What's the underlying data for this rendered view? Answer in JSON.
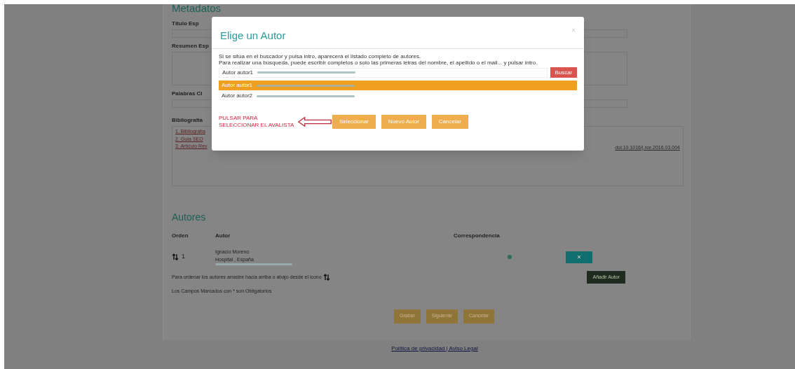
{
  "page": {
    "section_title": "Metadatos",
    "fields": [
      {
        "label": "Título Esp",
        "kind": "input"
      },
      {
        "label": "Resumen Esp",
        "kind": "textarea"
      },
      {
        "label": "Palabras Cl",
        "kind": "input"
      }
    ],
    "bibliography": {
      "label": "Bibliografía",
      "items": [
        "1. Bibliografía",
        "2. Guía SEO",
        "3. Artículo Rev"
      ],
      "trailing_link": "doi:10.1016/j.rce.2016.03.004"
    },
    "authors": {
      "title": "Autores",
      "columns": [
        "Orden",
        "Autor",
        "Correspondencia"
      ],
      "rows": [
        {
          "order": "1",
          "name": "Ignacio Moreno",
          "affiliation": "Hospital , España",
          "correspondence": true
        }
      ],
      "sort_hint": "Para ordenar los autores arrastre hacia arriba o abajo desde el icono",
      "required_note": "Los Campos Marcados con * son Obligatorios",
      "add_button": "Añadir Autor"
    },
    "buttons": [
      "Grabar",
      "Siguiente",
      "Cancelar"
    ],
    "footer_link": "Política de privacidad | Aviso Legal"
  },
  "dialog": {
    "title": "Elige un Autor",
    "close": "×",
    "help": [
      "Si se sitúa en el buscador y pulsa intro, aparecerá el listado completo de autores.",
      "Para realizar una búsqueda, puede escribir completos o solo las primeras letras del nombre, el apellido o el mail... y pulsar intro."
    ],
    "search": {
      "value": "Autor autor1",
      "button": "Buscar"
    },
    "results": [
      {
        "label": "Autor autor1",
        "selected": true
      },
      {
        "label": "Autor autor2",
        "selected": false
      }
    ],
    "note": "PULSAR PARA SELECCIONAR EL AVALISTA",
    "buttons": [
      "Seleccionar",
      "Nuevo Autor",
      "Cancelar"
    ]
  }
}
